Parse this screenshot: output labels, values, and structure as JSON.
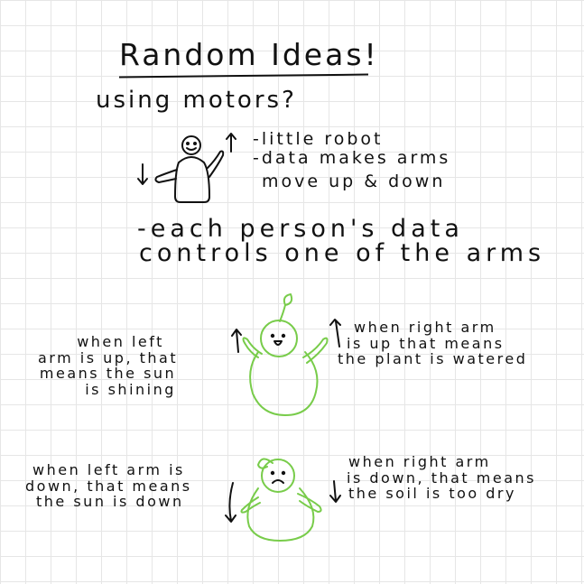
{
  "title": "Random Ideas!",
  "subtitle": "using motors?",
  "robot_notes": [
    "-little robot",
    "-data makes arms",
    "move up & down"
  ],
  "person_notes": [
    "-each person's data",
    "controls one of the arms"
  ],
  "happy_plant": {
    "left_caption": [
      "when left",
      "arm is up, that",
      "means the sun",
      "is shining"
    ],
    "right_caption": [
      "when right arm",
      "is up that means",
      "the plant is watered"
    ]
  },
  "sad_plant": {
    "left_caption": [
      "when left arm is",
      "down, that means",
      "the sun is down"
    ],
    "right_caption": [
      "when right arm",
      "is down, that means",
      "the soil is too dry"
    ]
  },
  "colors": {
    "ink": "#111111",
    "plant": "#78cc4a",
    "grid": "#e6e6e6"
  }
}
